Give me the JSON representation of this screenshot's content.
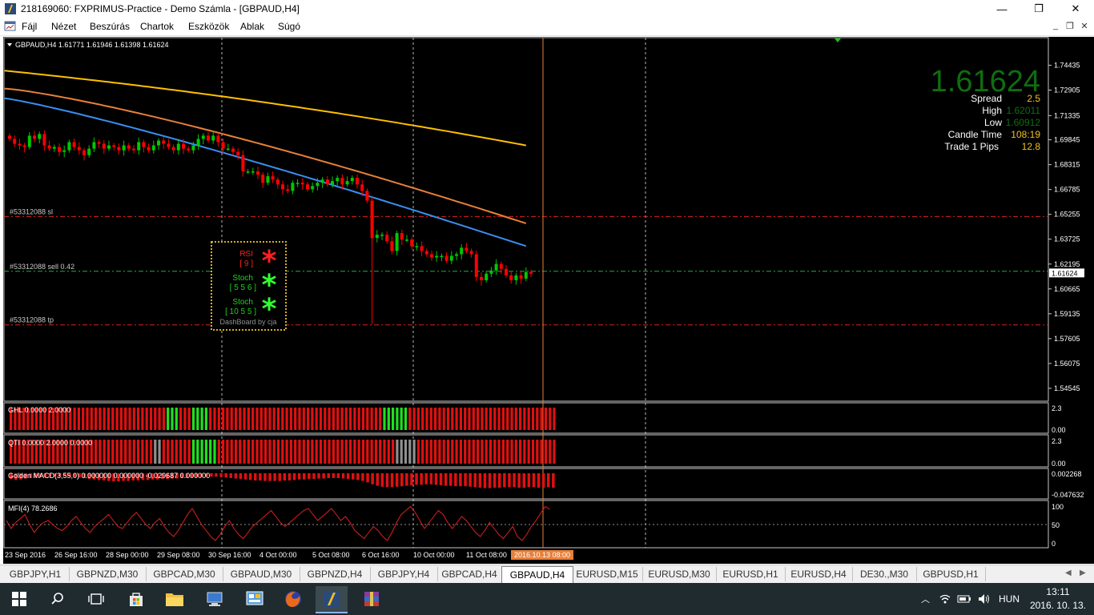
{
  "window": {
    "title": "218169060: FXPRIMUS-Practice - Demo Számla - [GBPAUD,H4]",
    "minimize": "—",
    "maximize": "❐",
    "close": "✕"
  },
  "menu": {
    "items": [
      "Fájl",
      "Nézet",
      "Beszúrás",
      "Chartok",
      "Eszközök",
      "Ablak",
      "Súgó"
    ],
    "mdi_minimize": "_",
    "mdi_restore": "❐",
    "mdi_close": "✕"
  },
  "chart": {
    "symbol_header": "GBPAUD,H4  1.61771 1.61946 1.61398 1.61624",
    "price_big": "1.61624",
    "info": [
      {
        "label": "Spread",
        "value": "2.5"
      },
      {
        "label": "High",
        "value": "1.62011"
      },
      {
        "label": "Low",
        "value": "1.60912"
      },
      {
        "label": "Candle Time",
        "value": "108:19"
      },
      {
        "label": "Trade 1 Pips",
        "value": "12.8"
      }
    ],
    "orders": {
      "sl_label": "#53312088 sl",
      "sell_label": "#53312088 sell 0.42",
      "tp_label": "#53312088 tp",
      "sl_price": 1.6512,
      "sell_price": 1.6175,
      "tp_price": 1.5845
    },
    "current_price": 1.61624,
    "current_price_label": "1.61624",
    "dashboard": {
      "rsi_label": "RSI",
      "rsi_param": "[ 9 ]",
      "stoch1_label": "Stoch",
      "stoch1_param": "[ 5 5 6 ]",
      "stoch2_label": "Stoch",
      "stoch2_param": "[ 10 5 5 ]",
      "credit": "DashBoard by cja"
    },
    "indicators": {
      "ghl": "GHL 0.0000 2.0000",
      "qti": "QTI 0.0000 2.0000 0.0000",
      "macd": "Golden MACD(3,55,0) 0.000000 0.000000 -0.029687 0.000000",
      "mfi": "MFI(4) 78.2686"
    },
    "sub_axes": {
      "ghl_top": "2.3",
      "ghl_bottom": "0.00",
      "qti_top": "2.3",
      "qti_bottom": "0.00",
      "macd_top": "0.002268",
      "macd_bottom": "-0.047632",
      "mfi_top": "100",
      "mfi_mid": "50",
      "mfi_bottom": "0"
    },
    "time_highlight": "2016.10.13 08:00",
    "colors": {
      "bull": "#00c800",
      "bear": "#ff0000",
      "ma_yellow": "#ffc000",
      "ma_orange": "#e8803a",
      "ma_blue": "#3a8ff0",
      "vline": "#e8803a",
      "price_big": "#0f6e0f"
    }
  },
  "chart_data": {
    "type": "candlestick",
    "y_ticks": [
      1.74435,
      1.72905,
      1.71335,
      1.69845,
      1.68315,
      1.66785,
      1.65255,
      1.63725,
      1.62195,
      1.60665,
      1.59135,
      1.57605,
      1.56075,
      1.54545
    ],
    "x_labels": [
      "23 Sep 2016",
      "26 Sep 16:00",
      "28 Sep 00:00",
      "29 Sep 08:00",
      "30 Sep 16:00",
      "4 Oct 00:00",
      "5 Oct 08:00",
      "6 Oct 16:00",
      "10 Oct 00:00",
      "11 Oct 08:00"
    ],
    "ylim": [
      1.54,
      1.75
    ],
    "close": [
      1.699,
      1.696,
      1.695,
      1.694,
      1.701,
      1.699,
      1.702,
      1.695,
      1.693,
      1.694,
      1.691,
      1.692,
      1.697,
      1.694,
      1.692,
      1.689,
      1.693,
      1.697,
      1.696,
      1.693,
      1.695,
      1.694,
      1.692,
      1.695,
      1.693,
      1.692,
      1.697,
      1.694,
      1.692,
      1.695,
      1.698,
      1.696,
      1.694,
      1.692,
      1.696,
      1.693,
      1.692,
      1.695,
      1.699,
      1.701,
      1.698,
      1.701,
      1.697,
      1.693,
      1.693,
      1.691,
      1.689,
      1.679,
      1.679,
      1.679,
      1.677,
      1.672,
      1.676,
      1.674,
      1.671,
      1.668,
      1.667,
      1.672,
      1.672,
      1.671,
      1.668,
      1.67,
      1.672,
      1.674,
      1.671,
      1.673,
      1.675,
      1.671,
      1.673,
      1.675,
      1.671,
      1.667,
      1.661,
      1.638,
      1.64,
      1.64,
      1.636,
      1.63,
      1.641,
      1.637,
      1.637,
      1.633,
      1.633,
      1.63,
      1.628,
      1.626,
      1.627,
      1.627,
      1.624,
      1.627,
      1.628,
      1.632,
      1.63,
      1.628,
      1.614,
      1.612,
      1.616,
      1.618,
      1.622,
      1.619,
      1.615,
      1.612,
      1.615,
      1.613,
      1.617,
      1.616
    ],
    "moving_averages": [
      {
        "color": "yellow",
        "start": 1.741,
        "end": 1.695
      },
      {
        "color": "orange",
        "start": 1.73,
        "end": 1.647
      },
      {
        "color": "blue",
        "start": 1.724,
        "end": 1.633
      }
    ],
    "ghl_colors": "rrrrrrrrrrrrrrrrrrrrrrrrrrrrrrrrrrrrrgggrrrggggrrrrrrrrrrrrrrrrrrrrrrrrrrrrrrrrrrrrrrrrrggggggrrrrrrrrrrrrrrrrrrrrrrrrrrrrrrrrrrrrrrrrrrrrrrrrrrrrrrrrrrrrrrr",
    "qti_colors": "rrrrrrrrrrrrrrrrrrrrrrrrrrrrrrrrrryyrrrrrrrggggggrrrrrrrrrrrrrrrrrrrrrrrrrrrrrrrrrrrrrrrrrryyyyyrrrrrrrrrrrrrrrrrrrrrrrrrrrrrrrrrrrrrrrrrrrrrrrrrrrrrrrr",
    "mfi": [
      60,
      40,
      55,
      65,
      75,
      50,
      30,
      45,
      55,
      60,
      50,
      40,
      35,
      45,
      60,
      70,
      55,
      40,
      30,
      45,
      55,
      65,
      75,
      60,
      45,
      40,
      55,
      70,
      80,
      65,
      50,
      40,
      55,
      65,
      45,
      30,
      20,
      35,
      55,
      75,
      90,
      70,
      50,
      35,
      20,
      10,
      25,
      45,
      60,
      40,
      25,
      15,
      30,
      45,
      55,
      65,
      75,
      85,
      70,
      55,
      45,
      55,
      65,
      75,
      85,
      90,
      75,
      60,
      70,
      80,
      90,
      75,
      60,
      70,
      55,
      35,
      25,
      15,
      30,
      45,
      35,
      20,
      10,
      30,
      55,
      75,
      85,
      95,
      80,
      60,
      40,
      55,
      70,
      85,
      75,
      55,
      40,
      55,
      70,
      60,
      45,
      30,
      20,
      35,
      55,
      40,
      25,
      15,
      30,
      45,
      20,
      10,
      25,
      45,
      60,
      78,
      95,
      88
    ],
    "macd": [
      -0.012,
      -0.014,
      -0.013,
      -0.011,
      -0.01,
      -0.009,
      -0.008,
      -0.008,
      -0.007,
      -0.007,
      -0.007,
      -0.006,
      -0.007,
      -0.008,
      -0.009,
      -0.01,
      -0.012,
      -0.013,
      -0.014,
      -0.015,
      -0.016,
      -0.017,
      -0.017,
      -0.016,
      -0.016,
      -0.015,
      -0.015,
      -0.014,
      -0.014,
      -0.013,
      -0.013,
      -0.012,
      -0.012,
      -0.011,
      -0.011,
      -0.01,
      -0.01,
      -0.009,
      -0.008,
      -0.008,
      -0.007,
      -0.007,
      -0.007,
      -0.008,
      -0.009,
      -0.01,
      -0.011,
      -0.012,
      -0.013,
      -0.014,
      -0.015,
      -0.015,
      -0.016,
      -0.016,
      -0.016,
      -0.016,
      -0.015,
      -0.015,
      -0.014,
      -0.013,
      -0.013,
      -0.012,
      -0.012,
      -0.011,
      -0.011,
      -0.01,
      -0.01,
      -0.01,
      -0.011,
      -0.012,
      -0.013,
      -0.014,
      -0.016,
      -0.019,
      -0.023,
      -0.026,
      -0.028,
      -0.029,
      -0.029,
      -0.028,
      -0.027,
      -0.026,
      -0.025,
      -0.024,
      -0.024,
      -0.023,
      -0.023,
      -0.024,
      -0.025,
      -0.026,
      -0.026,
      -0.027,
      -0.027,
      -0.027,
      -0.028,
      -0.029,
      -0.03,
      -0.031,
      -0.031,
      -0.03,
      -0.03,
      -0.029,
      -0.029,
      -0.029,
      -0.03,
      -0.03,
      -0.029,
      -0.029,
      -0.03,
      -0.03,
      -0.029,
      -0.03
    ]
  },
  "tabs": [
    "GBPJPY,H1",
    "GBPNZD,M30",
    "GBPCAD,M30",
    "GBPAUD,M30",
    "GBPNZD,H4",
    "GBPJPY,H4",
    "GBPCAD,H4",
    "GBPAUD,H4",
    "EURUSD,M15",
    "EURUSD,M30",
    "EURUSD,H1",
    "EURUSD,H4",
    "DE30.,M30",
    "GBPUSD,H1"
  ],
  "active_tab": "GBPAUD,H4",
  "taskbar": {
    "language": "HUN",
    "time": "13:11",
    "date": "2016. 10. 13."
  }
}
